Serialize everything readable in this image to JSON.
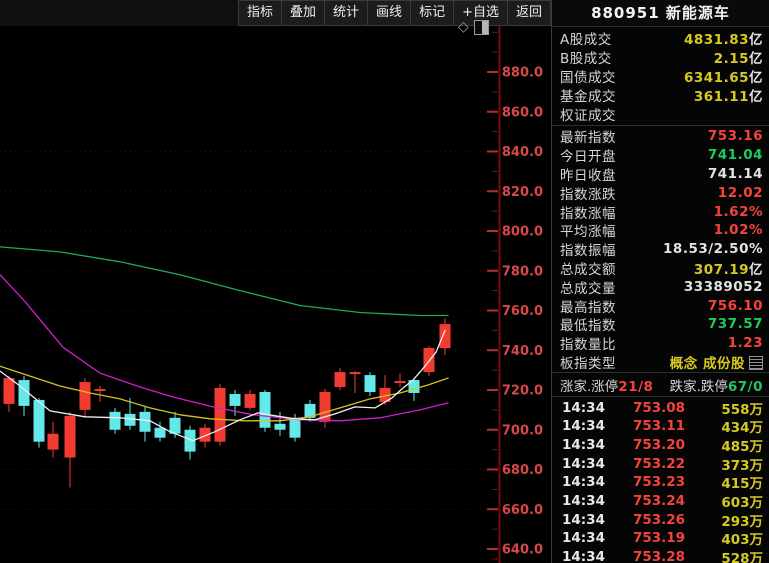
{
  "toolbar": {
    "buttons": [
      "指标",
      "叠加",
      "统计",
      "画线",
      "标记",
      "+自选",
      "返回"
    ]
  },
  "chart_tools": {
    "diamond_icon": "◇",
    "panel_icon": "panel-toggle"
  },
  "stock": {
    "code": "880951",
    "name": "新能源车"
  },
  "colors": {
    "red": "#f5433c",
    "green": "#1fc95e",
    "yellow": "#d6c922",
    "white": "#e2e2e2",
    "up_candle": "#f23b31",
    "down_candle": "#63e9e9",
    "ma_white": "#efefef",
    "ma_yellow": "#d2c41e",
    "ma_magenta": "#cf1ecf",
    "ma_green": "#23a857",
    "axis_label": "#d84848",
    "grid": "#4e0404",
    "axis_line": "#7a0909"
  },
  "panel": {
    "market_rows": [
      {
        "label": "A股成交",
        "value": "4831.83",
        "unit": "亿",
        "color": "yellow"
      },
      {
        "label": "B股成交",
        "value": "2.15",
        "unit": "亿",
        "color": "yellow"
      },
      {
        "label": "国债成交",
        "value": "6341.65",
        "unit": "亿",
        "color": "yellow"
      },
      {
        "label": "基金成交",
        "value": "361.11",
        "unit": "亿",
        "color": "yellow"
      },
      {
        "label": "权证成交",
        "value": "",
        "unit": "",
        "color": "yellow"
      }
    ],
    "index_rows": [
      {
        "label": "最新指数",
        "value": "753.16",
        "unit": "",
        "color": "red"
      },
      {
        "label": "今日开盘",
        "value": "741.04",
        "unit": "",
        "color": "green"
      },
      {
        "label": "昨日收盘",
        "value": "741.14",
        "unit": "",
        "color": "white"
      },
      {
        "label": "指数涨跌",
        "value": "12.02",
        "unit": "",
        "color": "red"
      },
      {
        "label": "指数涨幅",
        "value": "1.62%",
        "unit": "",
        "color": "red"
      },
      {
        "label": "平均涨幅",
        "value": "1.02%",
        "unit": "",
        "color": "red"
      },
      {
        "label": "指数振幅",
        "value": "18.53/2.50%",
        "unit": "",
        "color": "white"
      },
      {
        "label": "总成交额",
        "value": "307.19",
        "unit": "亿",
        "color": "yellow"
      },
      {
        "label": "总成交量",
        "value": "33389052",
        "unit": "",
        "color": "white"
      },
      {
        "label": "最高指数",
        "value": "756.10",
        "unit": "",
        "color": "red"
      },
      {
        "label": "最低指数",
        "value": "737.57",
        "unit": "",
        "color": "green"
      },
      {
        "label": "指数量比",
        "value": "1.23",
        "unit": "",
        "color": "red"
      },
      {
        "label": "板指类型",
        "value": "概念 成份股",
        "unit": "",
        "color": "yellow",
        "icon": "stock-list-icon"
      }
    ],
    "breadth": {
      "up_label": "涨家.涨停",
      "up_value": "21/8",
      "down_label": "跌家.跌停",
      "down_value": "67/0"
    },
    "tick_unit": "万",
    "ticks": [
      {
        "time": "14:34",
        "price": "753.08",
        "vol": "558"
      },
      {
        "time": "14:34",
        "price": "753.11",
        "vol": "434"
      },
      {
        "time": "14:34",
        "price": "753.20",
        "vol": "485"
      },
      {
        "time": "14:34",
        "price": "753.22",
        "vol": "373"
      },
      {
        "time": "14:34",
        "price": "753.23",
        "vol": "415"
      },
      {
        "time": "14:34",
        "price": "753.24",
        "vol": "603"
      },
      {
        "time": "14:34",
        "price": "753.26",
        "vol": "293"
      },
      {
        "time": "14:34",
        "price": "753.19",
        "vol": "403"
      },
      {
        "time": "14:34",
        "price": "753.28",
        "vol": "528"
      }
    ]
  },
  "chart_data": {
    "type": "candlestick",
    "title": "880951 新能源车 daily candles with MA overlays",
    "ylim": [
      633,
      916
    ],
    "grid": "dotted horizontal, dark red",
    "y_ticks": [
      {
        "label": "880.0",
        "value": 880
      },
      {
        "label": "860.0",
        "value": 860
      },
      {
        "label": "840.0",
        "value": 840
      },
      {
        "label": "820.0",
        "value": 820
      },
      {
        "label": "800.0",
        "value": 800
      },
      {
        "label": "780.0",
        "value": 780
      },
      {
        "label": "760.0",
        "value": 760
      },
      {
        "label": "740.0",
        "value": 740
      },
      {
        "label": "720.0",
        "value": 720
      },
      {
        "label": "700.0",
        "value": 700
      },
      {
        "label": "680.0",
        "value": 680
      },
      {
        "label": "660.0",
        "value": 660
      },
      {
        "label": "640.0",
        "value": 640
      }
    ],
    "y_minor_ticks": [
      900,
      890,
      870,
      850,
      830,
      810,
      790,
      770,
      750,
      730,
      710,
      690,
      670,
      650,
      635
    ],
    "candle_format": "[x_px, open, high, low, close]",
    "candles": [
      [
        9,
        713,
        727,
        709,
        726
      ],
      [
        24,
        725,
        727,
        707,
        712
      ],
      [
        39,
        715,
        716,
        691,
        694
      ],
      [
        53,
        690,
        704,
        686,
        698
      ],
      [
        70,
        686,
        709,
        671,
        707
      ],
      [
        85,
        710,
        726,
        706,
        724
      ],
      [
        100,
        719.5,
        722,
        714,
        720.5
      ],
      [
        115,
        709,
        711,
        698,
        700
      ],
      [
        130,
        708,
        716,
        700,
        702
      ],
      [
        145,
        709,
        712,
        694,
        699
      ],
      [
        160,
        701,
        704,
        694,
        696
      ],
      [
        175,
        706,
        709,
        696,
        698
      ],
      [
        190,
        700,
        702,
        685,
        689
      ],
      [
        205,
        694,
        703,
        691,
        701
      ],
      [
        220,
        694,
        723,
        692,
        721
      ],
      [
        235,
        718,
        720,
        707,
        712
      ],
      [
        250,
        711,
        720,
        710,
        718
      ],
      [
        265,
        719,
        720,
        699,
        701
      ],
      [
        280,
        703,
        709,
        697,
        700
      ],
      [
        295,
        706,
        708,
        694,
        696
      ],
      [
        310,
        713,
        715,
        704,
        706
      ],
      [
        325,
        704,
        720.5,
        701,
        719
      ],
      [
        340,
        721.5,
        731,
        720,
        729
      ],
      [
        355,
        728,
        729.5,
        718.5,
        729
      ],
      [
        370,
        727.5,
        729,
        717,
        719
      ],
      [
        385,
        714,
        727.5,
        712.5,
        721
      ],
      [
        400,
        723.5,
        728.5,
        721.5,
        724.5
      ],
      [
        414,
        725,
        726,
        714.5,
        718.5
      ],
      [
        429,
        729,
        742,
        727,
        741.14
      ],
      [
        445,
        741.04,
        756.1,
        737.57,
        753.16
      ]
    ],
    "series": [
      {
        "name": "ma-green",
        "color_key": "ma_green",
        "points": [
          [
            0,
            792
          ],
          [
            60,
            789.5
          ],
          [
            120,
            784.5
          ],
          [
            180,
            778
          ],
          [
            240,
            770
          ],
          [
            300,
            762.5
          ],
          [
            360,
            759
          ],
          [
            420,
            757.5
          ],
          [
            448,
            757.5
          ]
        ]
      },
      {
        "name": "ma-magenta",
        "color_key": "ma_magenta",
        "points": [
          [
            0,
            778
          ],
          [
            25,
            764.5
          ],
          [
            63,
            741.5
          ],
          [
            100,
            728.5
          ],
          [
            140,
            721.5
          ],
          [
            173,
            716.5
          ],
          [
            213,
            711.5
          ],
          [
            253,
            707.5
          ],
          [
            300,
            705
          ],
          [
            340,
            704.5
          ],
          [
            380,
            706
          ],
          [
            420,
            710
          ],
          [
            448,
            713.5
          ]
        ]
      },
      {
        "name": "ma-yellow",
        "color_key": "ma_yellow",
        "points": [
          [
            0,
            732
          ],
          [
            30,
            727
          ],
          [
            60,
            722
          ],
          [
            90,
            718.5
          ],
          [
            120,
            715.5
          ],
          [
            150,
            711
          ],
          [
            180,
            707.5
          ],
          [
            210,
            705.5
          ],
          [
            245,
            704.5
          ],
          [
            280,
            704.5
          ],
          [
            310,
            706.5
          ],
          [
            340,
            711
          ],
          [
            370,
            715.5
          ],
          [
            400,
            718.5
          ],
          [
            428,
            722.5
          ],
          [
            448,
            726
          ]
        ]
      },
      {
        "name": "ma-white",
        "color_key": "ma_white",
        "points": [
          [
            0,
            729.5
          ],
          [
            20,
            722
          ],
          [
            50,
            709.5
          ],
          [
            85,
            706.5
          ],
          [
            120,
            706
          ],
          [
            150,
            704.5
          ],
          [
            170,
            699
          ],
          [
            193,
            694.5
          ],
          [
            215,
            699
          ],
          [
            240,
            705
          ],
          [
            258,
            708.5
          ],
          [
            275,
            707
          ],
          [
            295,
            705.5
          ],
          [
            315,
            705
          ],
          [
            335,
            708
          ],
          [
            355,
            711.5
          ],
          [
            375,
            711
          ],
          [
            392,
            716
          ],
          [
            403,
            721
          ],
          [
            413,
            725
          ],
          [
            425,
            732
          ],
          [
            436,
            739
          ],
          [
            445,
            750
          ]
        ]
      }
    ]
  }
}
